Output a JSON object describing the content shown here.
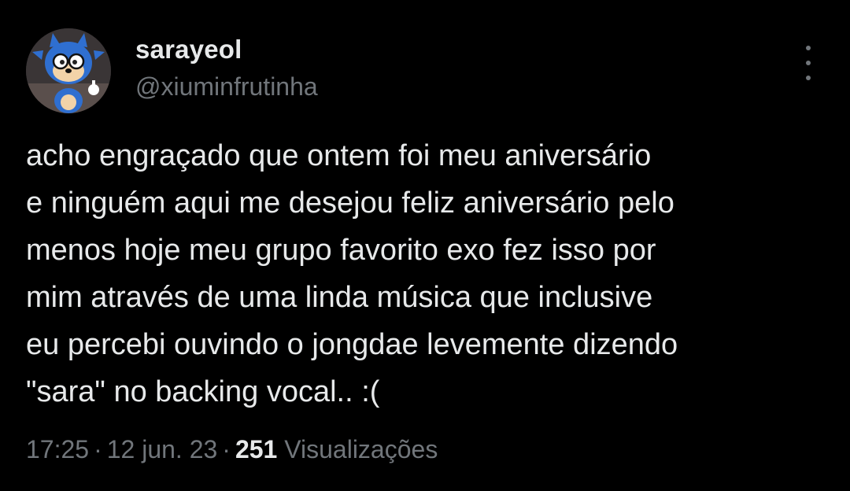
{
  "author": {
    "display_name": "sarayeol",
    "handle": "@xiuminfrutinha",
    "avatar_icon": "sonic-avatar-icon"
  },
  "more_button": {
    "icon": "more-vertical-icon"
  },
  "tweet": {
    "text": "acho engraçado que ontem foi meu aniversário\ne ninguém aqui me desejou feliz aniversário pelo\nmenos hoje meu grupo favorito exo fez isso por\nmim através de uma linda música que inclusive\neu percebi ouvindo o jongdae levemente dizendo\n\"sara\" no backing vocal.. :("
  },
  "meta": {
    "time": "17:25",
    "separator": "·",
    "date": "12 jun. 23",
    "views_count": "251",
    "views_label": "Visualizações"
  },
  "colors": {
    "background": "#000000",
    "primary_text": "#e7e9ea",
    "secondary_text": "#71767b"
  }
}
